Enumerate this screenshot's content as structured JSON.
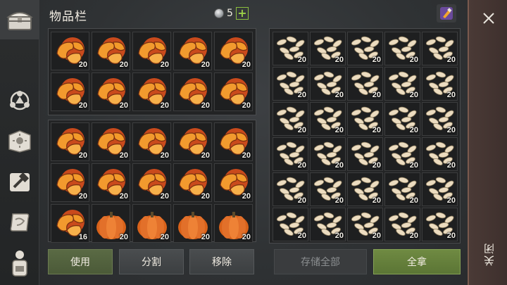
{
  "title": "物品栏",
  "currency": {
    "amount": "5",
    "add_label": "+"
  },
  "sidebar": {
    "items": [
      {
        "icon": "chest-icon",
        "active": true
      },
      {
        "icon": "settlement-icon"
      },
      {
        "icon": "sun-book-icon"
      },
      {
        "icon": "hammer-craft-icon"
      },
      {
        "icon": "scroll-map-icon"
      },
      {
        "icon": "backpack-character-icon"
      }
    ]
  },
  "inventory": {
    "top_grid": [
      {
        "item": "pumpkin-slices",
        "qty": "20"
      },
      {
        "item": "pumpkin-slices",
        "qty": "20"
      },
      {
        "item": "pumpkin-slices",
        "qty": "20"
      },
      {
        "item": "pumpkin-slices",
        "qty": "20"
      },
      {
        "item": "pumpkin-slices",
        "qty": "20"
      },
      {
        "item": "pumpkin-slices",
        "qty": "20"
      },
      {
        "item": "pumpkin-slices",
        "qty": "20"
      },
      {
        "item": "pumpkin-slices",
        "qty": "20"
      },
      {
        "item": "pumpkin-slices",
        "qty": "20"
      },
      {
        "item": "pumpkin-slices",
        "qty": "20"
      }
    ],
    "bottom_grid": [
      {
        "item": "pumpkin-slices",
        "qty": "20"
      },
      {
        "item": "pumpkin-slices",
        "qty": "20"
      },
      {
        "item": "pumpkin-slices",
        "qty": "20"
      },
      {
        "item": "pumpkin-slices",
        "qty": "20"
      },
      {
        "item": "pumpkin-slices",
        "qty": "20"
      },
      {
        "item": "pumpkin-slices",
        "qty": "20"
      },
      {
        "item": "pumpkin-slices",
        "qty": "20"
      },
      {
        "item": "pumpkin-slices",
        "qty": "20"
      },
      {
        "item": "pumpkin-slices",
        "qty": "20"
      },
      {
        "item": "pumpkin-slices",
        "qty": "20"
      },
      {
        "item": "pumpkin-slices",
        "qty": "16"
      },
      {
        "item": "pumpkin",
        "qty": "20"
      },
      {
        "item": "pumpkin",
        "qty": "20"
      },
      {
        "item": "pumpkin",
        "qty": "20"
      },
      {
        "item": "pumpkin",
        "qty": "20"
      }
    ],
    "buttons": {
      "use": "使用",
      "split": "分割",
      "remove": "移除"
    }
  },
  "storage": {
    "grid": [
      {
        "item": "pumpkin-seeds",
        "qty": "20"
      },
      {
        "item": "pumpkin-seeds",
        "qty": "20"
      },
      {
        "item": "pumpkin-seeds",
        "qty": "20"
      },
      {
        "item": "pumpkin-seeds",
        "qty": "20"
      },
      {
        "item": "pumpkin-seeds",
        "qty": "20"
      },
      {
        "item": "pumpkin-seeds",
        "qty": "20"
      },
      {
        "item": "pumpkin-seeds",
        "qty": "20"
      },
      {
        "item": "pumpkin-seeds",
        "qty": "20"
      },
      {
        "item": "pumpkin-seeds",
        "qty": "20"
      },
      {
        "item": "pumpkin-seeds",
        "qty": "20"
      },
      {
        "item": "pumpkin-seeds",
        "qty": "20"
      },
      {
        "item": "pumpkin-seeds",
        "qty": "20"
      },
      {
        "item": "pumpkin-seeds",
        "qty": "20"
      },
      {
        "item": "pumpkin-seeds",
        "qty": "20"
      },
      {
        "item": "pumpkin-seeds",
        "qty": "20"
      },
      {
        "item": "pumpkin-seeds",
        "qty": "20"
      },
      {
        "item": "pumpkin-seeds",
        "qty": "20"
      },
      {
        "item": "pumpkin-seeds",
        "qty": "20"
      },
      {
        "item": "pumpkin-seeds",
        "qty": "20"
      },
      {
        "item": "pumpkin-seeds",
        "qty": "20"
      },
      {
        "item": "pumpkin-seeds",
        "qty": "20"
      },
      {
        "item": "pumpkin-seeds",
        "qty": "20"
      },
      {
        "item": "pumpkin-seeds",
        "qty": "20"
      },
      {
        "item": "pumpkin-seeds",
        "qty": "20"
      },
      {
        "item": "pumpkin-seeds",
        "qty": "20"
      },
      {
        "item": "pumpkin-seeds",
        "qty": "20"
      },
      {
        "item": "pumpkin-seeds",
        "qty": "20"
      },
      {
        "item": "pumpkin-seeds",
        "qty": "20"
      },
      {
        "item": "pumpkin-seeds",
        "qty": "20"
      },
      {
        "item": "pumpkin-seeds",
        "qty": "20"
      }
    ],
    "buttons": {
      "store_all": "存储全部",
      "take_all": "全拿"
    }
  },
  "close_label": "关闭",
  "colors": {
    "accent_green": "#6f8a42",
    "close_bar": "#4a3a36",
    "orange_pumpkin": "#e07a1e"
  }
}
